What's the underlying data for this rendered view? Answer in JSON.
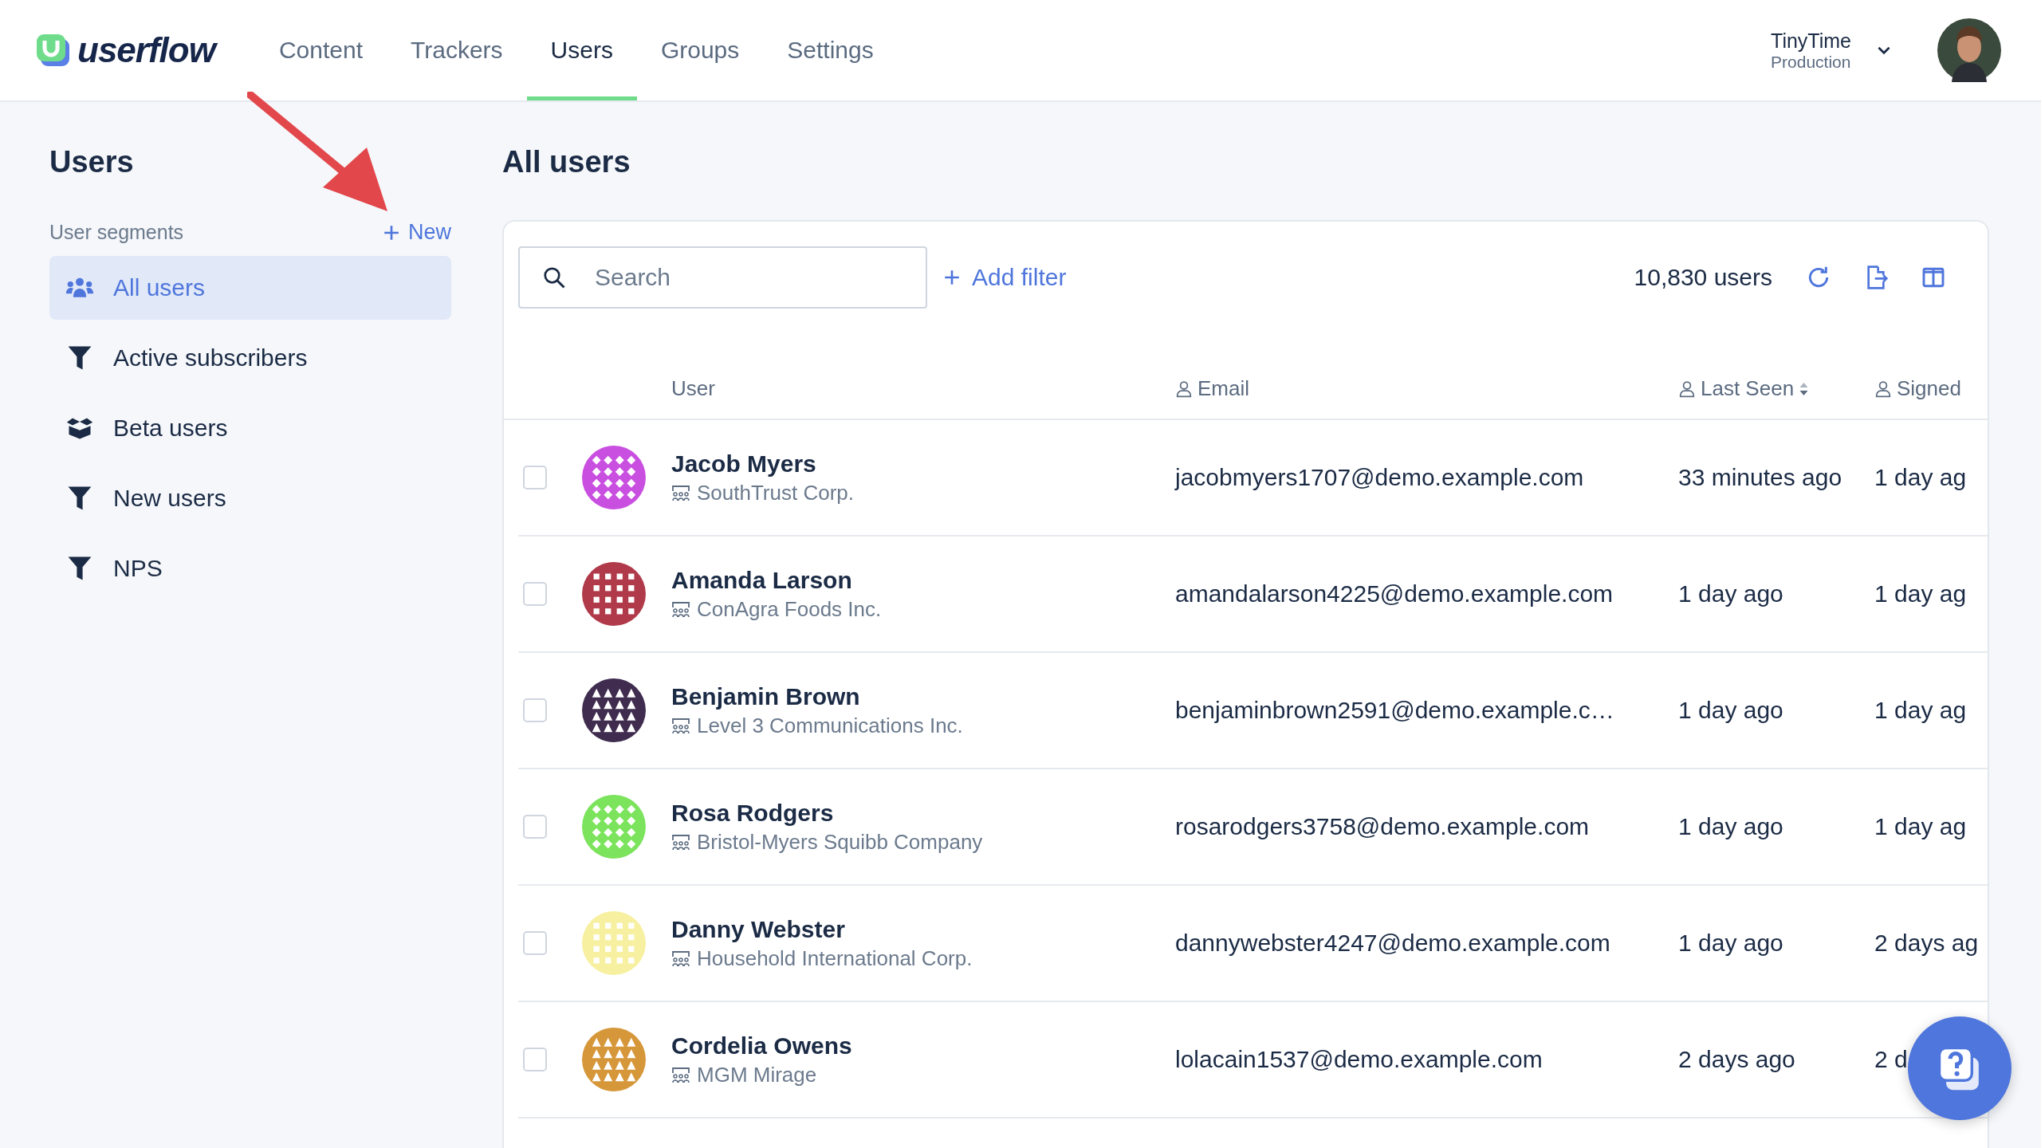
{
  "nav": {
    "logo": "userflow",
    "tabs": [
      {
        "label": "Content",
        "selected": false
      },
      {
        "label": "Trackers",
        "selected": false
      },
      {
        "label": "Users",
        "selected": true
      },
      {
        "label": "Groups",
        "selected": false
      },
      {
        "label": "Settings",
        "selected": false
      }
    ]
  },
  "account": {
    "name": "TinyTime",
    "environment": "Production"
  },
  "sidebar": {
    "title": "Users",
    "section": "User segments",
    "new_button": "New",
    "items": [
      {
        "label": "All users",
        "kind": "all",
        "selected": true
      },
      {
        "label": "Active subscribers",
        "kind": "filter",
        "selected": false
      },
      {
        "label": "Beta users",
        "kind": "box",
        "selected": false
      },
      {
        "label": "New users",
        "kind": "filter",
        "selected": false
      },
      {
        "label": "NPS",
        "kind": "filter",
        "selected": false
      }
    ]
  },
  "main": {
    "title": "All users",
    "search": {
      "placeholder": "Search"
    },
    "add_filter": "Add filter",
    "count": "10,830 users",
    "table": {
      "columns": [
        "User",
        "Email",
        "Last Seen",
        "Signed"
      ],
      "rows": [
        {
          "name": "Jacob Myers",
          "company": "SouthTrust Corp.",
          "email": "jacobmyers1707@demo.example.com",
          "last_seen": "33 minutes ago",
          "signed_up": "1 day ag",
          "color": "#c94fe0",
          "checked": false
        },
        {
          "name": "Amanda Larson",
          "company": "ConAgra Foods Inc.",
          "email": "amandalarson4225@demo.example.com",
          "last_seen": "1 day ago",
          "signed_up": "1 day ag",
          "color": "#b03a4a",
          "checked": false
        },
        {
          "name": "Benjamin Brown",
          "company": "Level 3 Communications Inc.",
          "email": "benjaminbrown2591@demo.example.c…",
          "last_seen": "1 day ago",
          "signed_up": "1 day ag",
          "color": "#3f2c4f",
          "checked": false
        },
        {
          "name": "Rosa Rodgers",
          "company": "Bristol-Myers Squibb Company",
          "email": "rosarodgers3758@demo.example.com",
          "last_seen": "1 day ago",
          "signed_up": "1 day ag",
          "color": "#7be35c",
          "checked": false
        },
        {
          "name": "Danny Webster",
          "company": "Household International Corp.",
          "email": "dannywebster4247@demo.example.com",
          "last_seen": "1 day ago",
          "signed_up": "2 days ag",
          "color": "#f7f0a0",
          "checked": false
        },
        {
          "name": "Cordelia Owens",
          "company": "MGM Mirage",
          "email": "lolacain1537@demo.example.com",
          "last_seen": "2 days ago",
          "signed_up": "2 d",
          "color": "#d6973a",
          "checked": false
        }
      ]
    }
  }
}
